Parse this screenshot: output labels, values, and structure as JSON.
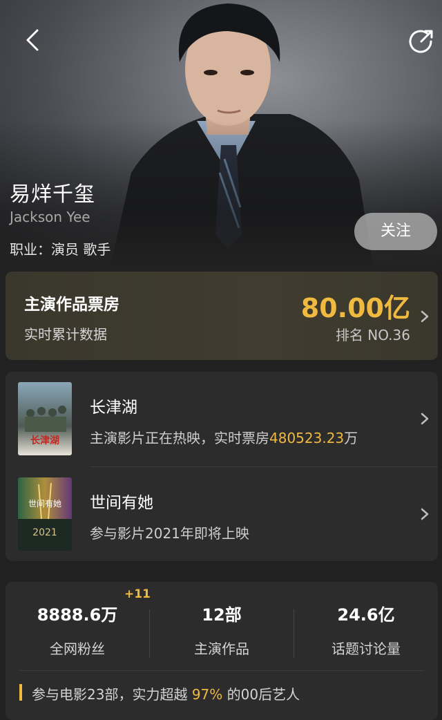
{
  "header": {
    "name": "易烊千玺",
    "english_name": "Jackson Yee",
    "job_label": "职业：",
    "job_value": "演员 歌手",
    "follow_label": "关注"
  },
  "box_office": {
    "title": "主演作品票房",
    "subtitle": "实时累计数据",
    "amount": "80.00亿",
    "rank": "排名 NO.36"
  },
  "films": [
    {
      "title": "长津湖",
      "desc_prefix": "主演影片正在热映，实时票房",
      "desc_value": "480523.23",
      "desc_suffix": "万",
      "poster_text": "长津湖"
    },
    {
      "title": "世间有她",
      "desc": "参与影片2021年即将上映",
      "poster_text": "世间有她",
      "poster_year": "2021"
    }
  ],
  "stats": [
    {
      "value": "8888.6万",
      "label": "全网粉丝",
      "badge": "+11"
    },
    {
      "value": "12部",
      "label": "主演作品"
    },
    {
      "value": "24.6亿",
      "label": "话题讨论量"
    }
  ],
  "footer": {
    "prefix": "参与电影23部，实力超越",
    "percent": "97%",
    "suffix": "的00后艺人"
  },
  "colors": {
    "accent_gold": "#f0b940",
    "background": "#212121",
    "card": "#2c2c2c"
  },
  "icons": [
    "back-arrow-icon",
    "share-icon",
    "chevron-right-icon"
  ]
}
